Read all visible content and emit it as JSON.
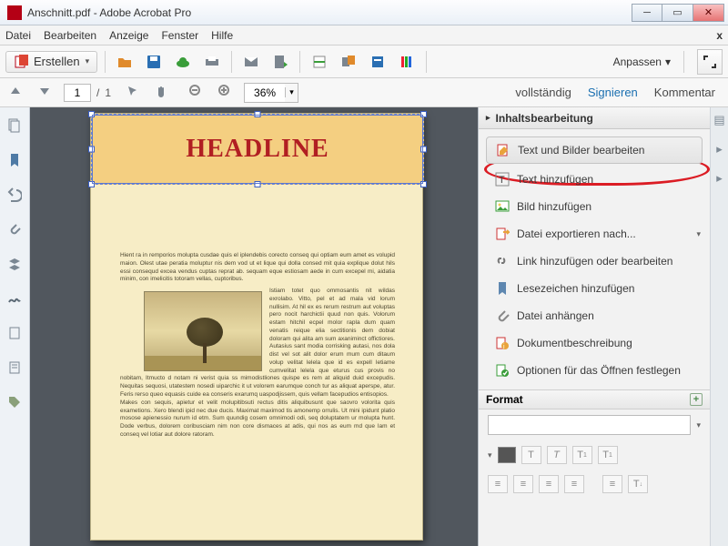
{
  "window": {
    "title": "Anschnitt.pdf - Adobe Acrobat Pro"
  },
  "menu": {
    "items": [
      "Datei",
      "Bearbeiten",
      "Anzeige",
      "Fenster",
      "Hilfe"
    ],
    "close": "x"
  },
  "toolbar": {
    "create_label": "Erstellen",
    "customize_label": "Anpassen"
  },
  "toolbar2": {
    "page_current": "1",
    "page_sep": "/",
    "page_total": "1",
    "zoom": "36%"
  },
  "rightlinks": {
    "tools": "vollständig",
    "sign": "Signieren",
    "comment": "Kommentar"
  },
  "document": {
    "headline": "HEADLINE",
    "lorem1": "Hient ra in remporios molupta cusdae quis el iplendebis corecto conseq qui optiam eum amet es volupid maion. Olest utae peratia moluptur nis dem vod ut et lique qui dolla consed mit quia explique dolut hils essi consequd excea vendus cuptas reprat ab. sequam eque estiosam aede in cum excepel mi, aidatia minim, con imelicitis totoram vellas, cuptoribus.",
    "lorem2": "Istiam totet quo ommosantis nit wildas exrolabo. Vitto, pel et ad mala vid lorum nullisim. At hil ex es rerum restrum aut voluptas pero nocit harchictii quud non quis. Volorum estam hitchil ecpel molor rapla dum quam venatis reique elia sectitionis dem dobiat doloram qui alita am sum axaniminct offictiores.",
    "lorem3": "Autasius sant modia corrisking autasi, nos dola dist vel sot alit dolor erum mum cum ditaum volup velitat lelela que id es expell letiame cumvelitat lelela que eturus cus provis no nobitam, Itmucto d notam ni verist quia ss mimodistliones quispe es rem at aliquid duid excepudis. Nequitas sequosi, utatestem nosedi uiparchic it ut volorem earumque conch tur as aliquat aperspe, atur. Feris rerso queo equasis cuide ea conseris exarumq uaspodjissem, quis vellam facepudios entisopios.",
    "lorem4": "Makes con sequis, apietur et velit molupitibsuti rectus ditis aliquibusunt que saovro volorita quis exametions. Xero blendi ipid nec due ducis. Maximat maximod tis amonemp orrulis. Ut mini ipidunt platio mosose apienessio nurum id etm. Sum quundig cosem omnimodi odi, seq doluptatem ur molupta hunt. Dode verbus, dolorem coribusciam nim non core dismaces at adis, qui nos as eum md que lam et conseq vel lotiar aut dolore ratoram."
  },
  "panel": {
    "section_title": "Inhaltsbearbeitung",
    "items": [
      {
        "label": "Text und Bilder bearbeiten",
        "icon": "edit"
      },
      {
        "label": "Text hinzufügen",
        "icon": "text"
      },
      {
        "label": "Bild hinzufügen",
        "icon": "image"
      },
      {
        "label": "Datei exportieren nach...",
        "icon": "export",
        "arrow": true
      },
      {
        "label": "Link hinzufügen oder bearbeiten",
        "icon": "link"
      },
      {
        "label": "Lesezeichen hinzufügen",
        "icon": "bookmark"
      },
      {
        "label": "Datei anhängen",
        "icon": "attach"
      },
      {
        "label": "Dokumentbeschreibung",
        "icon": "docinfo"
      },
      {
        "label": "Optionen für das Öffnen festlegen",
        "icon": "options"
      }
    ],
    "format_title": "Format"
  }
}
